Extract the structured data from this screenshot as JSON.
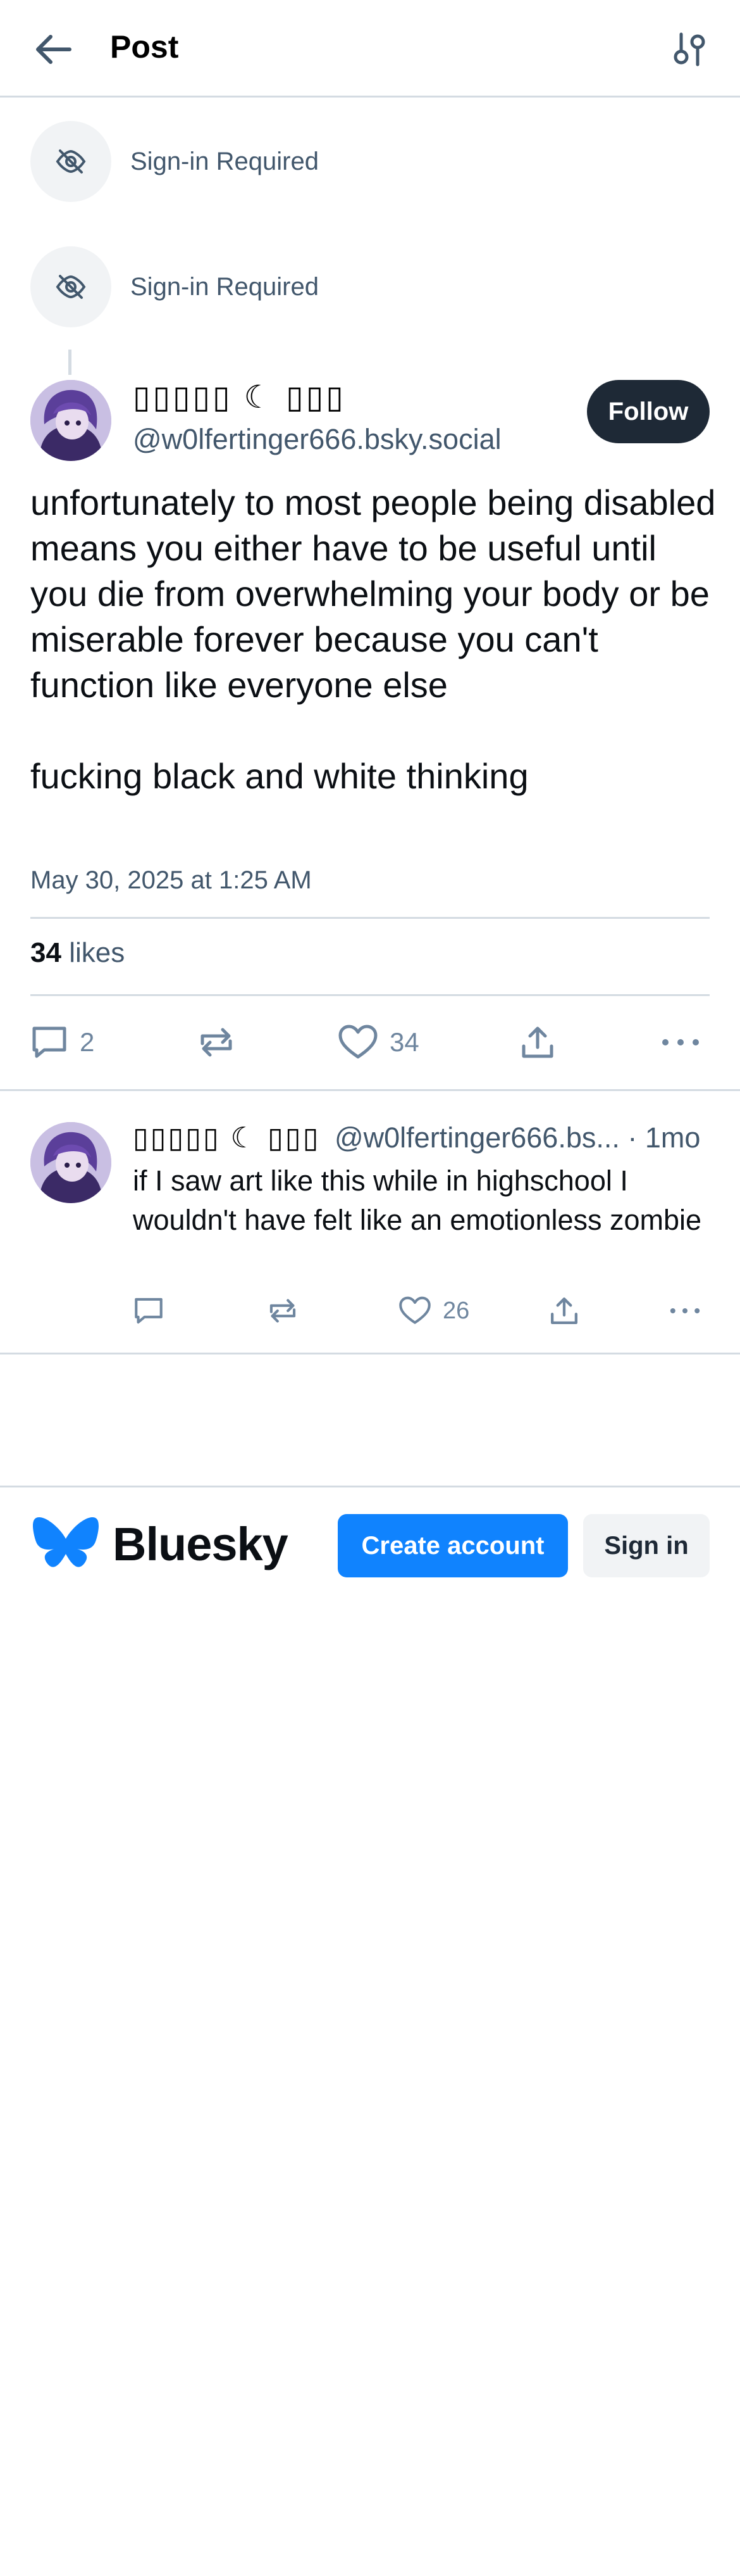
{
  "header": {
    "title": "Post",
    "back_icon": "arrow-left-icon",
    "settings_icon": "sliders-icon"
  },
  "hidden_parents": [
    {
      "label": "Sign-in Required",
      "icon": "eye-slash-icon"
    },
    {
      "label": "Sign-in Required",
      "icon": "eye-slash-icon"
    }
  ],
  "post": {
    "author_name": "▯▯▯▯▯ ☾ ▯▯▯",
    "author_handle": "@w0lfertinger666.bsky.social",
    "follow_label": "Follow",
    "body_paragraphs": [
      "unfortunately to most people being disabled means you either have to be useful until you die from overwhelming your body or be miserable forever because you can't function like everyone else",
      "fucking black and white thinking"
    ],
    "date": "May 30, 2025 at 1:25 AM",
    "likes_count": "34",
    "likes_label": "likes",
    "actions": {
      "reply_count": "2",
      "like_count": "34"
    }
  },
  "reply": {
    "author_name": "▯▯▯▯▯ ☾ ▯▯▯",
    "author_handle": "@w0lfertinger666.bs...",
    "time": "· 1mo",
    "body": "if I saw art like this while in highschool I wouldn't have felt like an emotionless zombie",
    "like_count": "26"
  },
  "footer": {
    "brand": "Bluesky",
    "create_account": "Create account",
    "sign_in": "Sign in"
  },
  "colors": {
    "accent": "#1083fe",
    "muted_text": "#42576c",
    "icon": "#6f869f",
    "follow_bg": "#1e2936"
  }
}
